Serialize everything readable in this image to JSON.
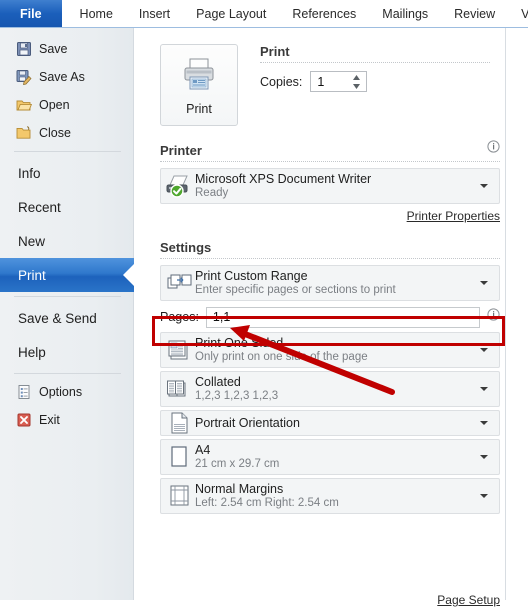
{
  "ribbon": {
    "tabs": [
      {
        "label": "File",
        "selected": true
      },
      {
        "label": "Home",
        "selected": false
      },
      {
        "label": "Insert",
        "selected": false
      },
      {
        "label": "Page Layout",
        "selected": false
      },
      {
        "label": "References",
        "selected": false
      },
      {
        "label": "Mailings",
        "selected": false
      },
      {
        "label": "Review",
        "selected": false
      },
      {
        "label": "View",
        "selected": false
      }
    ]
  },
  "sidebar": {
    "items": [
      {
        "label": "Save",
        "icon": "save-icon",
        "type": "icon"
      },
      {
        "label": "Save As",
        "icon": "save-as-icon",
        "type": "icon"
      },
      {
        "label": "Open",
        "icon": "open-folder-icon",
        "type": "icon"
      },
      {
        "label": "Close",
        "icon": "close-folder-icon",
        "type": "icon"
      },
      {
        "label": "Info",
        "icon": "",
        "type": "plain"
      },
      {
        "label": "Recent",
        "icon": "",
        "type": "plain"
      },
      {
        "label": "New",
        "icon": "",
        "type": "plain"
      },
      {
        "label": "Print",
        "icon": "",
        "type": "selected"
      },
      {
        "label": "Save & Send",
        "icon": "",
        "type": "plain"
      },
      {
        "label": "Help",
        "icon": "",
        "type": "plain"
      },
      {
        "label": "Options",
        "icon": "options-icon",
        "type": "icon"
      },
      {
        "label": "Exit",
        "icon": "exit-icon",
        "type": "icon"
      }
    ]
  },
  "print": {
    "button_label": "Print",
    "button_icon": "printer-icon",
    "section_title": "Print",
    "copies_label": "Copies:",
    "copies_value": "1"
  },
  "printer": {
    "section_title": "Printer",
    "info_icon": "info-icon",
    "name": "Microsoft XPS Document Writer",
    "status": "Ready",
    "status_icon": "green-check-icon",
    "properties_link": "Printer Properties"
  },
  "settings": {
    "section_title": "Settings",
    "rows": [
      {
        "name": "print-range",
        "icon": "custom-range-icon",
        "title": "Print Custom Range",
        "subtitle": "Enter specific pages or sections to print"
      },
      {
        "name": "print-sides",
        "icon": "one-sided-icon",
        "title": "Print One Sided",
        "subtitle": "Only print on one side of the page"
      },
      {
        "name": "collation",
        "icon": "collated-icon",
        "title": "Collated",
        "subtitle": "1,2,3   1,2,3   1,2,3"
      },
      {
        "name": "orientation",
        "icon": "portrait-icon",
        "title": "Portrait Orientation",
        "subtitle": ""
      },
      {
        "name": "paper-size",
        "icon": "paper-icon",
        "title": "A4",
        "subtitle": "21 cm x 29.7 cm"
      },
      {
        "name": "margins",
        "icon": "margins-icon",
        "title": "Normal Margins",
        "subtitle": "Left:  2.54 cm    Right:  2.54 cm"
      }
    ],
    "pages_label": "Pages:",
    "pages_value": "1,1",
    "pages_info_icon": "info-icon",
    "page_setup_link": "Page Setup"
  },
  "annotation": {
    "highlight_color": "#c00000",
    "arrow_color": "#c00000",
    "target": "pages-input"
  }
}
